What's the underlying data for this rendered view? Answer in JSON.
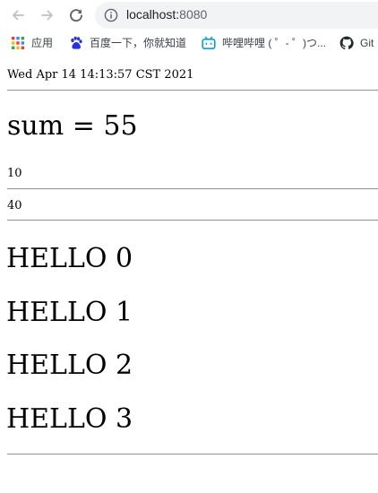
{
  "browser": {
    "url_host": "localhost:",
    "url_port": "8080",
    "bookmarks": [
      {
        "label": "应用",
        "icon": "apps-grid-icon"
      },
      {
        "label": "百度一下，你就知道",
        "icon": "baidu-paw-icon"
      },
      {
        "label": "哔哩哔哩 ( ゜- ゜)つ...",
        "icon": "bilibili-tv-icon"
      },
      {
        "label": "Git",
        "icon": "github-icon"
      }
    ]
  },
  "page": {
    "date": "Wed Apr 14 14:13:57 CST 2021",
    "sum_text": "sum = 55",
    "numbers": [
      "10",
      "40"
    ],
    "hellos": [
      "HELLO 0",
      "HELLO 1",
      "HELLO 2",
      "HELLO 3"
    ]
  }
}
